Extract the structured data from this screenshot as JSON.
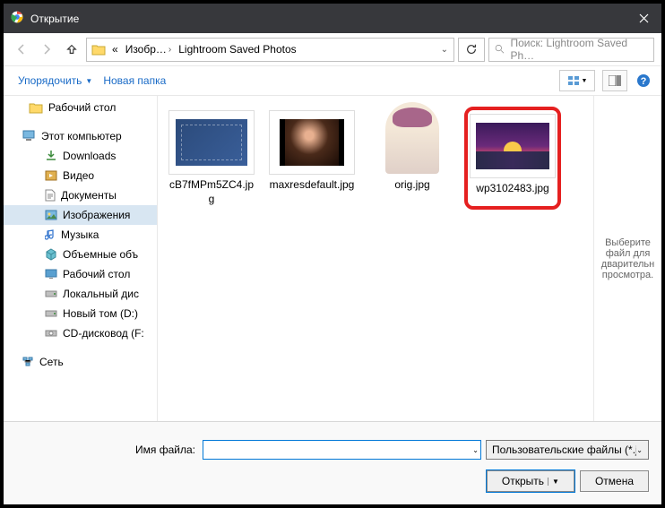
{
  "titlebar": {
    "title": "Открытие"
  },
  "breadcrumb": {
    "chevPrefix": "«",
    "item1": "Изобр…",
    "item2": "Lightroom Saved Photos"
  },
  "search": {
    "placeholder": "Поиск: Lightroom Saved Ph…"
  },
  "toolbar": {
    "organize": "Упорядочить",
    "newFolder": "Новая папка"
  },
  "tree": {
    "desktop": "Рабочий стол",
    "thisPc": "Этот компьютер",
    "downloads": "Downloads",
    "video": "Видео",
    "documents": "Документы",
    "pictures": "Изображения",
    "music": "Музыка",
    "objects3d": "Объемные объ",
    "desktop2": "Рабочий стол",
    "localdisk": "Локальный дис",
    "newvol": "Новый том (D:)",
    "cddrive": "CD-дисковод (F:",
    "network": "Сеть"
  },
  "files": {
    "f1": "cB7fMPm5ZC4.jpg",
    "f2": "maxresdefault.jpg",
    "f3": "orig.jpg",
    "f4": "wp3102483.jpg"
  },
  "preview": {
    "text": "Выберите файл для дварительн просмотра."
  },
  "bottom": {
    "filenameLabel": "Имя файла:",
    "filenameValue": "",
    "filetype": "Пользовательские файлы (*.jf",
    "open": "Открыть",
    "cancel": "Отмена"
  }
}
